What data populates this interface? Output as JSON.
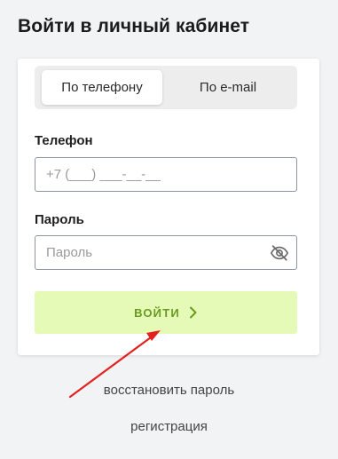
{
  "page": {
    "title": "Войти в личный кабинет"
  },
  "tabs": {
    "phone": "По телефону",
    "email": "По e-mail"
  },
  "phone": {
    "label": "Телефон",
    "placeholder": "+7 (___) ___-__-__"
  },
  "password": {
    "label": "Пароль",
    "placeholder": "Пароль",
    "icon": "eye-slash-icon"
  },
  "login": {
    "label": "ВОЙТИ",
    "icon": "chevron-right-icon"
  },
  "links": {
    "restore": "восстановить пароль",
    "register": "регистрация"
  },
  "colors": {
    "accent_bg": "#e6fab8",
    "accent_text": "#6a9a1f",
    "annotation_arrow": "#e3211f"
  }
}
